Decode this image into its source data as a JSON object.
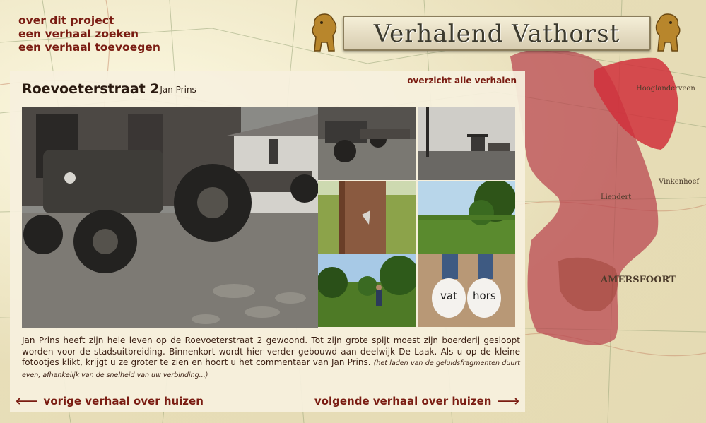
{
  "nav": {
    "items": [
      "over dit project",
      "een verhaal zoeken",
      "een verhaal toevoegen"
    ]
  },
  "logo": {
    "text": "Verhalend Vathorst"
  },
  "story": {
    "title": "Roevoeterstraat 2",
    "separator": "-",
    "author": "Jan Prins",
    "overview_link": "overzicht alle verhalen",
    "description": "Jan Prins heeft zijn hele leven op de Roevoeterstraat 2 gewoond. Tot zijn grote spijt moest zijn boerderij gesloopt worden voor de stadsuitbreiding. Binnenkort wordt hier verder gebouwd aan deelwijk De Laak. Als u op de kleine fotootjes klikt, krijgt u ze groter te zien en hoort u het commentaar van Jan Prins.",
    "loading_note": "(het laden van de geluidsfragmenten duurt even, afhankelijk van de snelheid van uw verbinding...)",
    "clog_text_left": "vat",
    "clog_text_right": "hors"
  },
  "pagination": {
    "prev_label": "vorige verhaal over huizen",
    "next_label": "volgende verhaal over huizen",
    "prev_arrow": "⟵",
    "next_arrow": "⟶"
  },
  "map": {
    "labels": [
      "Hooglanderveen",
      "Vinkenhoef",
      "AMERSFOORT",
      "Liendert"
    ]
  },
  "colors": {
    "accent": "#7a1c12",
    "map_overlay": "#b8434e",
    "map_highlight": "#d0303b"
  }
}
